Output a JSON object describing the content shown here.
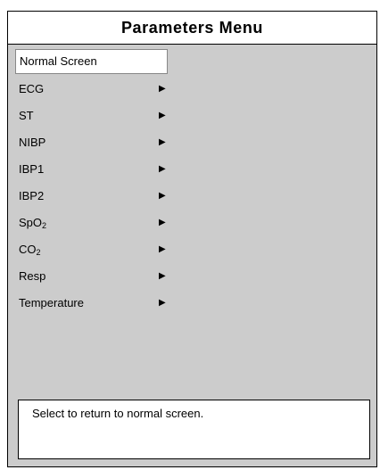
{
  "menu": {
    "title": "Parameters Menu",
    "items": [
      {
        "label": "Normal Screen",
        "selected": true,
        "submenu": false
      },
      {
        "label": "ECG",
        "submenu": true
      },
      {
        "label": "ST",
        "submenu": true
      },
      {
        "label": "NIBP",
        "submenu": true
      },
      {
        "label": "IBP1",
        "submenu": true
      },
      {
        "label": "IBP2",
        "submenu": true
      },
      {
        "label_main": "SpO",
        "label_sub": "2",
        "submenu": true
      },
      {
        "label_main": "CO",
        "label_sub": "2",
        "submenu": true
      },
      {
        "label": "Resp",
        "submenu": true
      },
      {
        "label": "Temperature",
        "submenu": true
      }
    ],
    "submenu_icon": "triangle-right-icon"
  },
  "help": {
    "text": "Select to return to normal screen."
  },
  "colors": {
    "background": "#cccccc",
    "panel": "#ffffff",
    "border": "#000000"
  }
}
